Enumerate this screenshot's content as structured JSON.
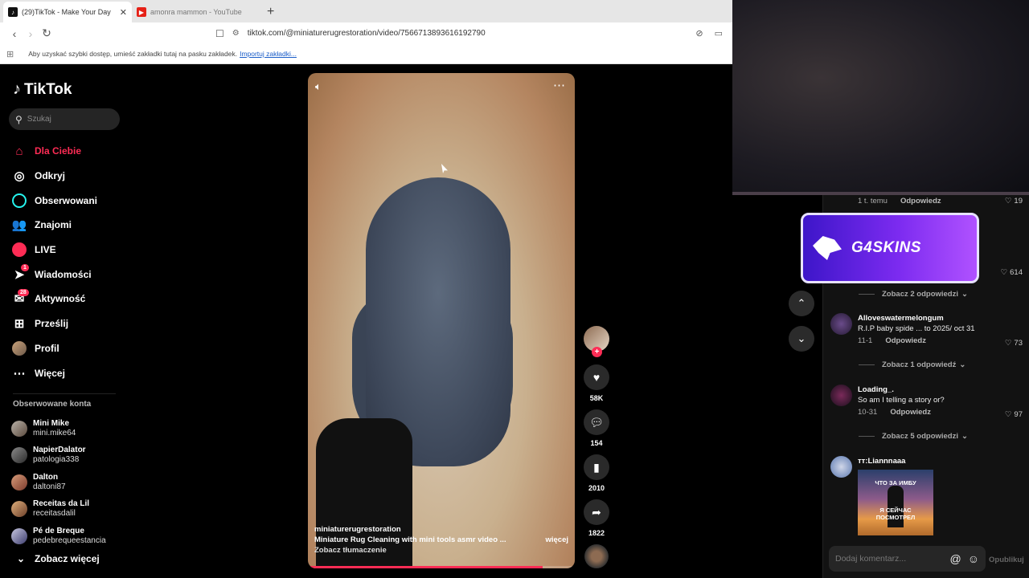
{
  "browser": {
    "tabs": [
      {
        "title": "(29)TikTok - Make Your Day",
        "active": true,
        "favicon": "tiktok-favicon"
      },
      {
        "title": "amonra mammon - YouTube",
        "active": false,
        "favicon": "youtube-favicon"
      }
    ],
    "new_tab": "+",
    "url_host": "tiktok.com",
    "url_path": "/@miniaturerugrestoration/video/7566713893616192790",
    "bookmarks_hint": "Aby uzyskać szybki dostęp, umieść zakładki tutaj na pasku zakładek.",
    "bookmarks_link": "Importuj zakładki..."
  },
  "sidebar": {
    "logo": "TikTok",
    "search_placeholder": "Szukaj",
    "menu": [
      {
        "label": "Dla Ciebie",
        "icon": "home-icon",
        "active": true
      },
      {
        "label": "Odkryj",
        "icon": "compass-icon"
      },
      {
        "label": "Obserwowani",
        "icon": "following-icon"
      },
      {
        "label": "Znajomi",
        "icon": "friends-icon"
      },
      {
        "label": "LIVE",
        "icon": "live-icon"
      },
      {
        "label": "Wiadomości",
        "icon": "messages-icon",
        "badge": "1"
      },
      {
        "label": "Aktywność",
        "icon": "activity-icon",
        "badge": "28"
      },
      {
        "label": "Prześlij",
        "icon": "upload-icon"
      },
      {
        "label": "Profil",
        "icon": "profile-icon"
      },
      {
        "label": "Więcej",
        "icon": "more-icon"
      }
    ],
    "following_title": "Obserwowane konta",
    "following": [
      {
        "name": "Mini Mike",
        "handle": "mini.mike64"
      },
      {
        "name": "NapierDalator",
        "handle": "patologia338"
      },
      {
        "name": "Dalton",
        "handle": "daltoni87"
      },
      {
        "name": "Receitas da Lil",
        "handle": "receitasdalil"
      },
      {
        "name": "Pé de Breque",
        "handle": "pedebrequeestancia"
      }
    ],
    "see_more": "Zobacz więcej"
  },
  "video": {
    "author": "miniaturerugrestoration",
    "description": "Miniature Rug Cleaning with mini tools asmr video ...",
    "more": "więcej",
    "translate": "Zobacz tłumaczenie",
    "progress": 0.88
  },
  "actions": {
    "likes": "58K",
    "comments": "154",
    "saves": "2010",
    "shares": "1822"
  },
  "comments": {
    "top_meta": {
      "time": "1 t. temu",
      "reply": "Odpowiedz",
      "likes": "19"
    },
    "ad_text": "G4SKINS",
    "ad_likes": "614",
    "view_replies_1": "Zobacz 2 odpowiedzi",
    "items": [
      {
        "name": "Alloveswatermelongum",
        "text": "R.I.P baby spide ... to 2025/ oct 31",
        "date": "11-1",
        "reply": "Odpowiedz",
        "likes": "73",
        "view_replies": "Zobacz 1 odpowiedź"
      },
      {
        "name": "Loading_.",
        "text": "So am I telling a story or?",
        "date": "10-31",
        "reply": "Odpowiedz",
        "likes": "97",
        "view_replies": "Zobacz 5 odpowiedzi"
      },
      {
        "name": "ᴛᴛ:Liannnaaa",
        "image_text_top": "ЧТО ЗА ИМБУ",
        "image_text_bottom": "Я СЕЙЧАС ПОСМОТРЕЛ"
      }
    ],
    "composer_placeholder": "Dodaj komentarz...",
    "publish": "Opublikuj"
  }
}
